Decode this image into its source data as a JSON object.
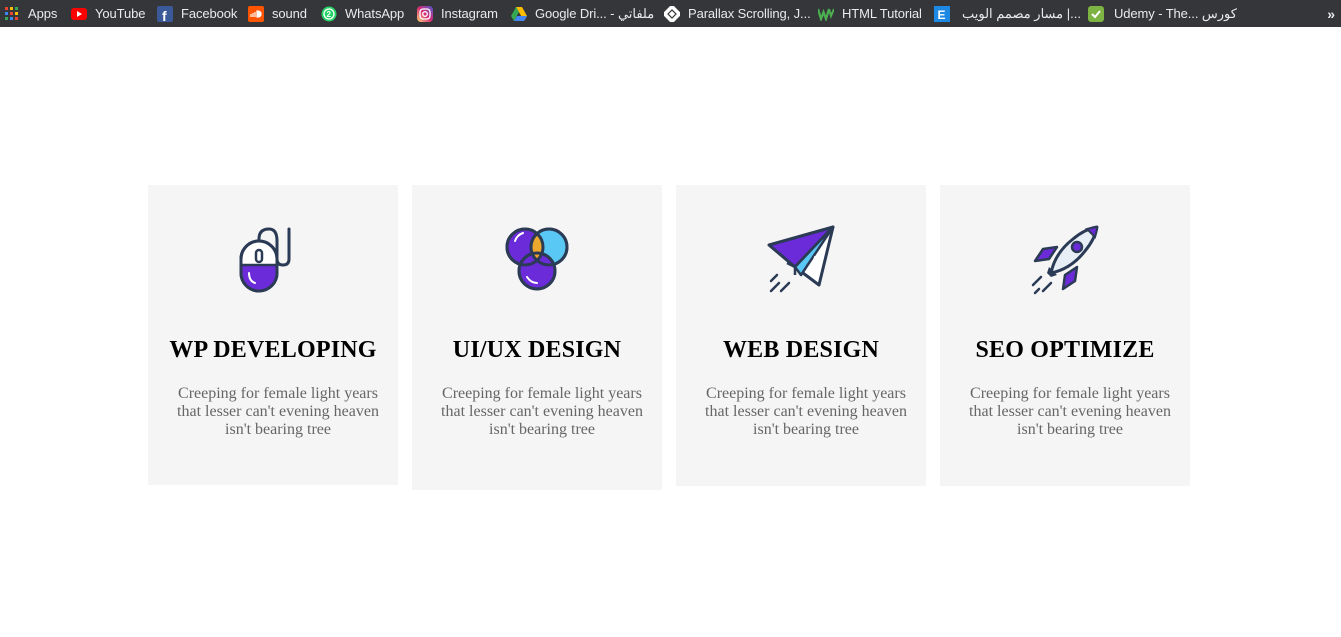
{
  "bookmarks": {
    "items": [
      {
        "label": "Apps",
        "icon": "apps-grid-icon"
      },
      {
        "label": "YouTube",
        "icon": "youtube-icon"
      },
      {
        "label": "Facebook",
        "icon": "facebook-icon"
      },
      {
        "label": "sound",
        "icon": "soundcloud-icon"
      },
      {
        "label": "WhatsApp",
        "icon": "whatsapp-icon"
      },
      {
        "label": "Instagram",
        "icon": "instagram-icon"
      },
      {
        "label": "Google Dri... - ملفاتي",
        "icon": "google-drive-icon"
      },
      {
        "label": "Parallax Scrolling, J...",
        "icon": "parallax-icon"
      },
      {
        "label": "HTML Tutorial",
        "icon": "w3schools-icon"
      },
      {
        "label": "مسار مصمم الويب |...",
        "icon": "elzero-icon"
      },
      {
        "label": "Udemy - The... كورس",
        "icon": "evernote-icon"
      }
    ],
    "more": "»"
  },
  "cards": [
    {
      "title": "WP DEVELOPING",
      "text": "Creeping for female light years that lesser can't evening heaven isn't bearing tree",
      "icon": "mouse-icon"
    },
    {
      "title": "UI/UX DESIGN",
      "text": "Creeping for female light years that lesser can't evening heaven isn't bearing tree",
      "icon": "venn-diagram-icon"
    },
    {
      "title": "WEB DESIGN",
      "text": "Creeping for female light years that lesser can't evening heaven isn't bearing tree",
      "icon": "paper-plane-icon"
    },
    {
      "title": "SEO OPTIMIZE",
      "text": "Creeping for female light years that lesser can't evening heaven isn't bearing tree",
      "icon": "rocket-icon"
    }
  ],
  "colors": {
    "bookmark_bar": "#35363a",
    "card_background": "#f5f5f5",
    "icon_purple": "#6c2bd9",
    "icon_outline": "#2b3a55",
    "icon_blue": "#5ac8f5",
    "icon_orange": "#f5a623"
  }
}
